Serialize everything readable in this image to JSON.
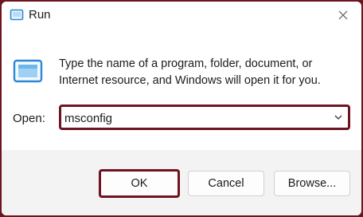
{
  "window": {
    "title": "Run",
    "close_glyph": "✕"
  },
  "dialog": {
    "description": "Type the name of a program, folder, document, or Internet resource, and Windows will open it for you.",
    "open_label": "Open:",
    "open_value": "msconfig"
  },
  "buttons": {
    "ok": "OK",
    "cancel": "Cancel",
    "browse": "Browse..."
  },
  "colors": {
    "highlight": "#6e1420",
    "icon_blue": "#2b88d8"
  },
  "icons": {
    "title": "run-app-icon",
    "main": "run-app-icon",
    "close": "close-icon",
    "dropdown": "chevron-down-icon"
  }
}
